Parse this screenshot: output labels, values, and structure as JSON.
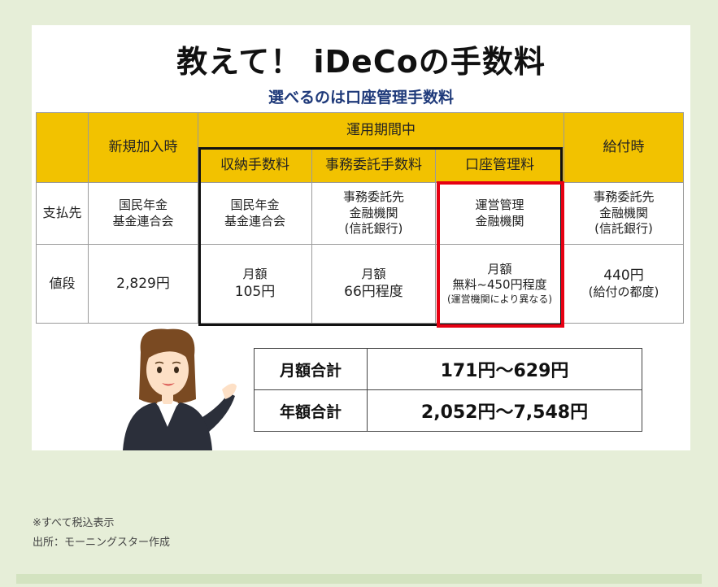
{
  "title": "教えて！ iDeCoの手数料",
  "subtitle": "選べるのは口座管理手数料",
  "table": {
    "header_enroll": "新規加入時",
    "header_operation": "運用期間中",
    "header_benefit": "給付時",
    "sub_collection": "収納手数料",
    "sub_admin": "事務委託手数料",
    "sub_account": "口座管理料",
    "row_payee_label": "支払先",
    "payee_enroll_1": "国民年金",
    "payee_enroll_2": "基金連合会",
    "payee_collection_1": "国民年金",
    "payee_collection_2": "基金連合会",
    "payee_admin_1": "事務委託先",
    "payee_admin_2": "金融機関",
    "payee_admin_3": "(信託銀行)",
    "payee_account_1": "運営管理",
    "payee_account_2": "金融機関",
    "payee_benefit_1": "事務委託先",
    "payee_benefit_2": "金融機関",
    "payee_benefit_3": "(信託銀行)",
    "row_price_label": "値段",
    "price_enroll": "2,829円",
    "price_collection_1": "月額",
    "price_collection_2": "105円",
    "price_admin_1": "月額",
    "price_admin_2": "66円程度",
    "price_account_1": "月額",
    "price_account_2": "無料~450円程度",
    "price_account_3": "(運営機関により異なる)",
    "price_benefit_1": "440円",
    "price_benefit_2": "(給付の都度)"
  },
  "totals": {
    "monthly_label": "月額合計",
    "monthly_value": "171円～629円",
    "annual_label": "年額合計",
    "annual_value": "2,052円～7,548円"
  },
  "footnotes": {
    "tax_note": "※すべて税込表示",
    "source": "出所：モーニングスター作成"
  },
  "colors": {
    "header_yellow": "#f2c200",
    "highlight_red": "#e60012",
    "subtitle_blue": "#1f3a7a",
    "page_bg": "#e6eed8"
  }
}
